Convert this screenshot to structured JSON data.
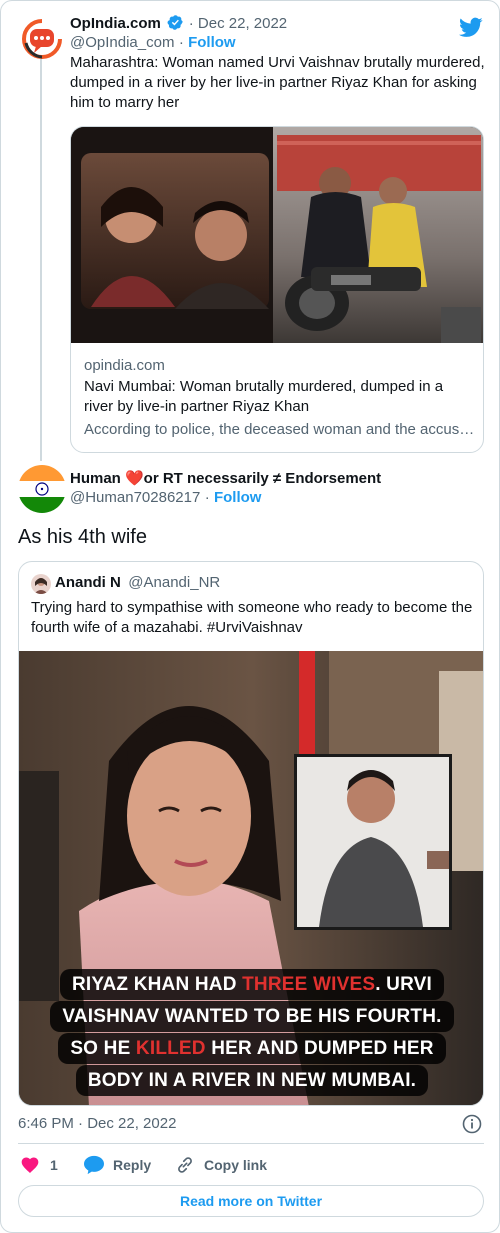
{
  "tweet1": {
    "author_name": "OpIndia.com",
    "handle": "@OpIndia_com",
    "date": "Dec 22, 2022",
    "follow": "Follow",
    "text": "Maharashtra: Woman named Urvi Vaishnav brutally murdered, dumped in a river by her live-in partner Riyaz Khan for asking him to marry her",
    "link_card": {
      "domain": "opindia.com",
      "title": "Navi Mumbai: Woman brutally murdered, dumped in a river by live-in partner Riyaz Khan",
      "description": "According to police, the deceased woman and the accus…"
    }
  },
  "tweet2": {
    "author_name": "Human ❤️or RT necessarily ≠ Endorsement",
    "handle": "@Human70286217",
    "follow": "Follow",
    "text": "As his 4th wife",
    "quote": {
      "author_name": "Anandi N",
      "handle": "@Anandi_NR",
      "text": "Trying hard to sympathise with someone who ready to become the fourth wife of a mazahabi. #UrviVaishnav",
      "overlay": {
        "line1_a": "RIYAZ KHAN HAD ",
        "line1_b": "THREE WIVES",
        "line1_c": ". URVI",
        "line2": "VAISHNAV WANTED TO BE HIS FOURTH.",
        "line3_a": "SO HE ",
        "line3_b": "KILLED",
        "line3_c": " HER AND DUMPED HER",
        "line4": "BODY IN A RIVER IN NEW MUMBAI."
      }
    },
    "timestamp": "6:46 PM · Dec 22, 2022",
    "likes": "1",
    "reply": "Reply",
    "copy_link": "Copy link",
    "read_more": "Read more on Twitter"
  },
  "colors": {
    "accent": "#1d9bf0",
    "like": "#f91880",
    "overlay_red": "#e0312f",
    "verified": "#1d9bf0"
  },
  "icons": [
    "twitter-bird-icon",
    "verified-badge-icon",
    "heart-icon",
    "reply-icon",
    "link-icon",
    "info-icon",
    "india-flag-avatar",
    "opindia-logo-avatar"
  ]
}
